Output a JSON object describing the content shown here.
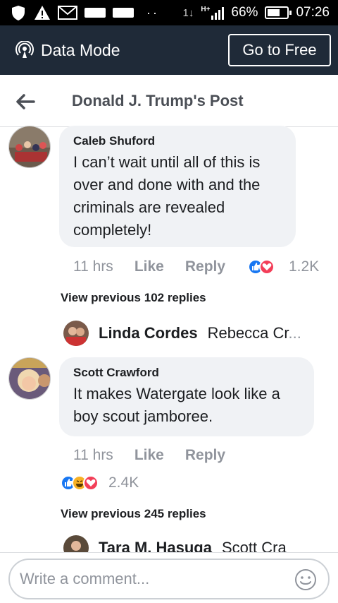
{
  "status_bar": {
    "battery": "66%",
    "battery_level": 0.66,
    "time": "07:26",
    "network": "H+",
    "data_arrows": "1↓",
    "icons": [
      "shield-icon",
      "warning-icon",
      "gmail-icon",
      "notification-icon",
      "notification-icon",
      "more-dots-icon",
      "signal-icon",
      "battery-icon"
    ]
  },
  "data_mode": {
    "label": "Data Mode",
    "icon": "broadcast-icon",
    "button": "Go to Free"
  },
  "header": {
    "title": "Donald J. Trump's Post",
    "back_icon": "back-arrow-icon"
  },
  "comments": [
    {
      "name": "Caleb Shuford",
      "text": "I can’t wait until all of this is over and done with and the criminals are revealed completely!",
      "time": "11 hrs",
      "like": "Like",
      "reply": "Reply",
      "reaction_count": "1.2K",
      "reactions": [
        "like",
        "love"
      ]
    },
    {
      "name": "Scott Crawford",
      "text": "It makes Watergate look like a boy scout jamboree.",
      "time": "11 hrs",
      "like": "Like",
      "reply": "Reply",
      "reaction_count": "2.4K",
      "reactions": [
        "like",
        "haha",
        "love"
      ]
    }
  ],
  "view_previous": [
    "View previous 102 replies",
    "View previous 245 replies"
  ],
  "reply_previews": [
    {
      "name": "Linda Cordes",
      "text": "Rebecca Cr",
      "ellipsis": "..."
    },
    {
      "name": "Tara M. Hasuga",
      "text": "Scott Cra",
      "ellipsis": ""
    }
  ],
  "composer": {
    "placeholder": "Write a comment...",
    "icon": "emoji-icon"
  }
}
